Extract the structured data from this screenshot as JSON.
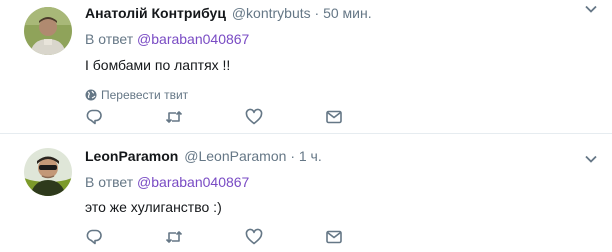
{
  "tweets": [
    {
      "fullname": "Анатолій Контрибуц",
      "username": "@kontrybuts",
      "dot": "·",
      "time": "50 мин.",
      "reply_prefix": "В ответ",
      "reply_mention": "@baraban040867",
      "text": "І бомбами по лаптях !!",
      "translate": "Перевести твит"
    },
    {
      "fullname": "LeonParamon",
      "username": "@LeonParamon",
      "dot": "·",
      "time": "1 ч.",
      "reply_prefix": "В ответ",
      "reply_mention": "@baraban040867",
      "text": "это же хулиганство :)"
    }
  ],
  "icons": {
    "reply": "reply-icon",
    "retweet": "retweet-icon",
    "like": "heart-icon",
    "dm": "envelope-icon",
    "globe": "globe-icon",
    "caret": "chevron-down-icon"
  },
  "colors": {
    "text": "#14171a",
    "secondary": "#657786",
    "mention": "#794bc4",
    "separator": "#e6ecf0"
  }
}
